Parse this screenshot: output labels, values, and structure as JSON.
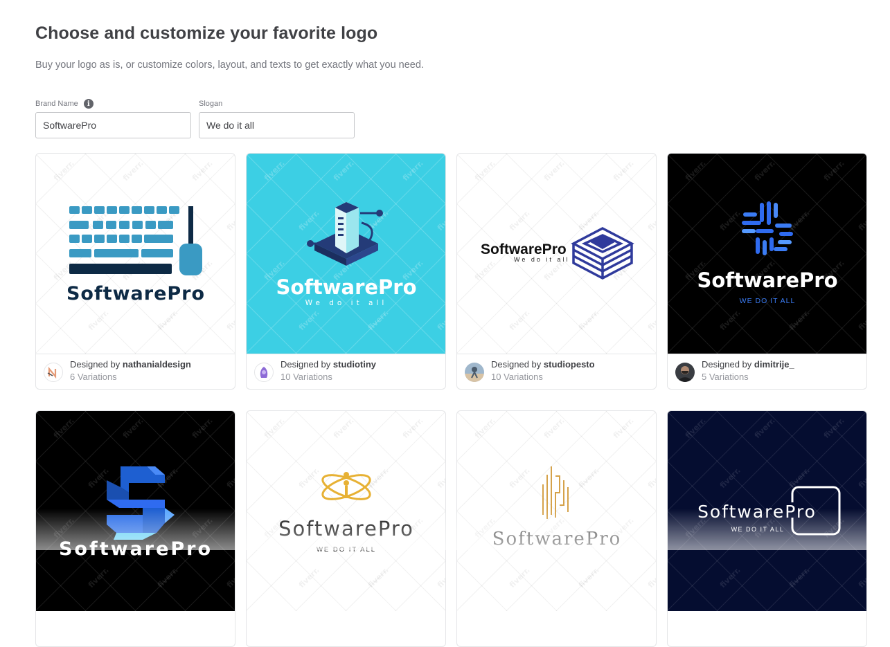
{
  "header": {
    "title": "Choose and customize your favorite logo",
    "subtitle": "Buy your logo as is, or customize colors, layout, and texts to get exactly what you need."
  },
  "form": {
    "brand_name_label": "Brand Name",
    "brand_name_value": "SoftwarePro",
    "slogan_label": "Slogan",
    "slogan_value": "We do it all",
    "info_icon": "info-icon"
  },
  "watermark": "fiverr.",
  "cards": [
    {
      "bg": "#ffffff",
      "brand": "SoftwarePro",
      "slogan": "",
      "designed_by": "Designed by",
      "designer": "nathanialdesign",
      "variations": "6 Variations"
    },
    {
      "bg": "#3ccfe4",
      "brand": "SoftwarePro",
      "slogan": "We do it all",
      "designed_by": "Designed by",
      "designer": "studiotiny",
      "variations": "10 Variations"
    },
    {
      "bg": "#ffffff",
      "brand": "SoftwarePro",
      "slogan": "We do it all",
      "designed_by": "Designed by",
      "designer": "studiopesto",
      "variations": "10 Variations"
    },
    {
      "bg": "#000000",
      "brand": "SoftwarePro",
      "slogan": "WE DO IT ALL",
      "designed_by": "Designed by",
      "designer": "dimitrije_",
      "variations": "5 Variations"
    },
    {
      "bg": "#000000",
      "brand": "SoftwarePro",
      "slogan": ""
    },
    {
      "bg": "#ffffff",
      "brand": "SoftwarePro",
      "slogan": "WE DO IT ALL"
    },
    {
      "bg": "#ffffff",
      "brand": "SoftwarePro",
      "slogan": ""
    },
    {
      "bg": "#050d30",
      "brand": "SoftwarePro",
      "slogan": "WE DO IT ALL"
    }
  ]
}
